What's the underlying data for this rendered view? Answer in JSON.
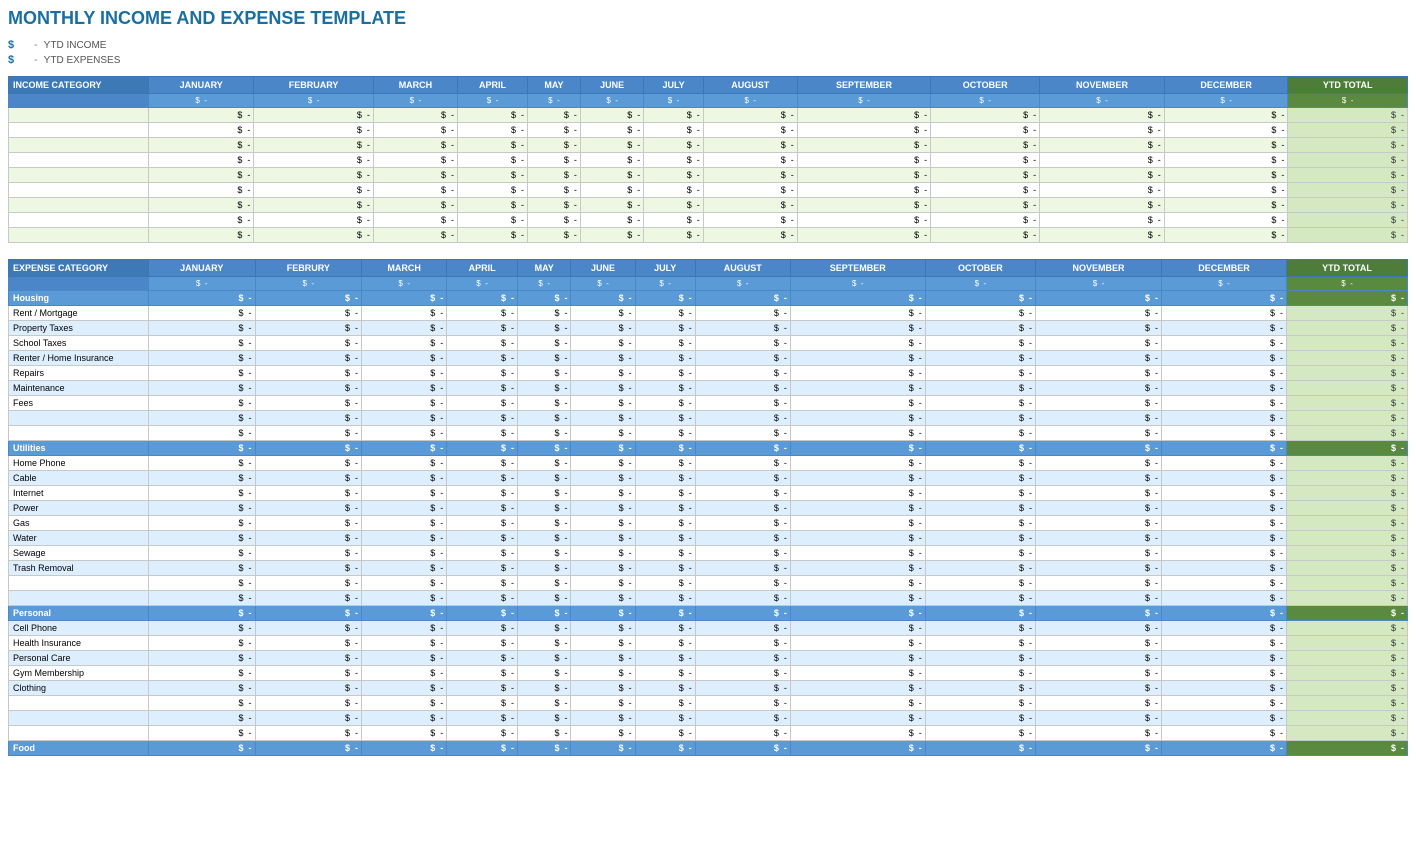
{
  "title": "MONTHLY INCOME AND EXPENSE TEMPLATE",
  "summary": {
    "ytd_income_label": "YTD INCOME",
    "ytd_expenses_label": "YTD EXPENSES",
    "dollar_sign": "$",
    "dash": "-"
  },
  "months": [
    "JANUARY",
    "FEBRUARY",
    "MARCH",
    "APRIL",
    "MAY",
    "JUNE",
    "JULY",
    "AUGUST",
    "SEPTEMBER",
    "OCTOBER",
    "NOVEMBER",
    "DECEMBER"
  ],
  "months_expense": [
    "JANUARY",
    "FEBRURY",
    "MARCH",
    "APRIL",
    "MAY",
    "JUNE",
    "JULY",
    "AUGUST",
    "SEPTEMBER",
    "OCTOBER",
    "NOVEMBER",
    "DECEMBER"
  ],
  "ytd_total": "YTD TOTAL",
  "income": {
    "category_label": "INCOME CATEGORY",
    "rows": [
      {
        "label": "",
        "values": [
          "$  -",
          "$  -",
          "$  -",
          "$  -",
          "$  -",
          "$  -",
          "$  -",
          "$  -",
          "$  -",
          "$  -",
          "$  -",
          "$  -"
        ],
        "ytd": "$  -"
      },
      {
        "label": "",
        "values": [
          "$  -",
          "$  -",
          "$  -",
          "$  -",
          "$  -",
          "$  -",
          "$  -",
          "$  -",
          "$  -",
          "$  -",
          "$  -",
          "$  -"
        ],
        "ytd": "$  -"
      },
      {
        "label": "",
        "values": [
          "$  -",
          "$  -",
          "$  -",
          "$  -",
          "$  -",
          "$  -",
          "$  -",
          "$  -",
          "$  -",
          "$  -",
          "$  -",
          "$  -"
        ],
        "ytd": "$  -"
      },
      {
        "label": "",
        "values": [
          "$  -",
          "$  -",
          "$  -",
          "$  -",
          "$  -",
          "$  -",
          "$  -",
          "$  -",
          "$  -",
          "$  -",
          "$  -",
          "$  -"
        ],
        "ytd": "$  -"
      },
      {
        "label": "",
        "values": [
          "$  -",
          "$  -",
          "$  -",
          "$  -",
          "$  -",
          "$  -",
          "$  -",
          "$  -",
          "$  -",
          "$  -",
          "$  -",
          "$  -"
        ],
        "ytd": "$  -"
      },
      {
        "label": "",
        "values": [
          "$  -",
          "$  -",
          "$  -",
          "$  -",
          "$  -",
          "$  -",
          "$  -",
          "$  -",
          "$  -",
          "$  -",
          "$  -",
          "$  -"
        ],
        "ytd": "$  -"
      },
      {
        "label": "",
        "values": [
          "$  -",
          "$  -",
          "$  -",
          "$  -",
          "$  -",
          "$  -",
          "$  -",
          "$  -",
          "$  -",
          "$  -",
          "$  -",
          "$  -"
        ],
        "ytd": "$  -"
      },
      {
        "label": "",
        "values": [
          "$  -",
          "$  -",
          "$  -",
          "$  -",
          "$  -",
          "$  -",
          "$  -",
          "$  -",
          "$  -",
          "$  -",
          "$  -",
          "$  -"
        ],
        "ytd": "$  -"
      },
      {
        "label": "",
        "values": [
          "$  -",
          "$  -",
          "$  -",
          "$  -",
          "$  -",
          "$  -",
          "$  -",
          "$  -",
          "$  -",
          "$  -",
          "$  -",
          "$  -"
        ],
        "ytd": "$  -"
      }
    ]
  },
  "expense": {
    "category_label": "EXPENSE CATEGORY",
    "sections": [
      {
        "name": "Housing",
        "rows": [
          {
            "label": "Rent / Mortgage"
          },
          {
            "label": "Property Taxes"
          },
          {
            "label": "School Taxes"
          },
          {
            "label": "Renter / Home Insurance"
          },
          {
            "label": "Repairs"
          },
          {
            "label": "Maintenance"
          },
          {
            "label": "Fees"
          },
          {
            "label": ""
          },
          {
            "label": ""
          }
        ]
      },
      {
        "name": "Utilities",
        "rows": [
          {
            "label": "Home Phone"
          },
          {
            "label": "Cable"
          },
          {
            "label": "Internet"
          },
          {
            "label": "Power"
          },
          {
            "label": "Gas"
          },
          {
            "label": "Water"
          },
          {
            "label": "Sewage"
          },
          {
            "label": "Trash Removal"
          },
          {
            "label": ""
          },
          {
            "label": ""
          }
        ]
      },
      {
        "name": "Personal",
        "rows": [
          {
            "label": "Cell Phone"
          },
          {
            "label": "Health Insurance"
          },
          {
            "label": "Personal Care"
          },
          {
            "label": "Gym Membership"
          },
          {
            "label": "Clothing"
          },
          {
            "label": ""
          },
          {
            "label": ""
          },
          {
            "label": ""
          }
        ]
      },
      {
        "name": "Food",
        "rows": []
      }
    ]
  }
}
